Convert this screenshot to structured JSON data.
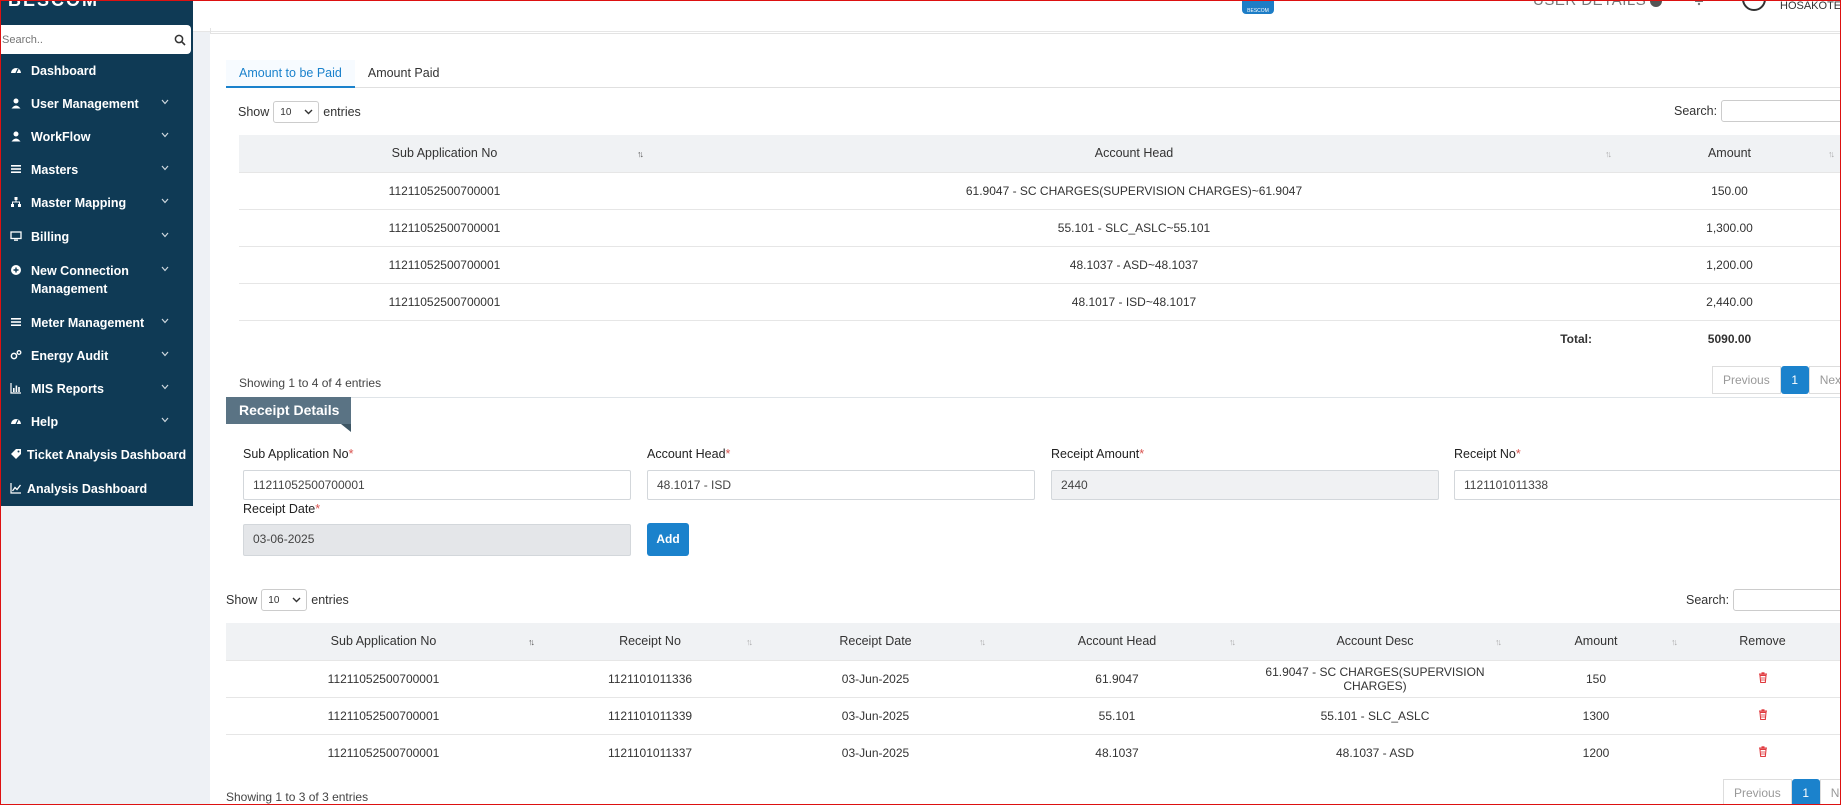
{
  "sidebar": {
    "brand": "BESCOM",
    "search_placeholder": "Search..",
    "items": [
      {
        "label": "Dashboard",
        "icon": "dashboard-icon",
        "chevron": false
      },
      {
        "label": "User Management",
        "icon": "user-icon",
        "chevron": true
      },
      {
        "label": "WorkFlow",
        "icon": "user-icon",
        "chevron": true
      },
      {
        "label": "Masters",
        "icon": "list-icon",
        "chevron": true
      },
      {
        "label": "Master Mapping",
        "icon": "sitemap-icon",
        "chevron": true
      },
      {
        "label": "Billing",
        "icon": "monitor-icon",
        "chevron": true
      },
      {
        "label": "New Connection Management",
        "icon": "plus-circle-icon",
        "chevron": true
      },
      {
        "label": "Meter Management",
        "icon": "list-icon",
        "chevron": true
      },
      {
        "label": "Energy Audit",
        "icon": "cogs-icon",
        "chevron": true
      },
      {
        "label": "MIS Reports",
        "icon": "bar-chart-icon",
        "chevron": true
      },
      {
        "label": "Help",
        "icon": "dashboard-icon",
        "chevron": true
      },
      {
        "label": "Ticket Analysis Dashboard",
        "icon": "tag-icon",
        "chevron": false
      },
      {
        "label": "Analysis Dashboard",
        "icon": "line-chart-icon",
        "chevron": false
      }
    ]
  },
  "header": {
    "logo_text": "BESCOM",
    "user_details": "USER DETAILS",
    "location": "HOSAKOTE"
  },
  "tabs": [
    {
      "label": "Amount to be Paid",
      "active": true
    },
    {
      "label": "Amount Paid",
      "active": false
    }
  ],
  "table1": {
    "show_label": "Show",
    "entries_label": "entries",
    "page_size": "10",
    "search_label": "Search:",
    "columns": [
      "Sub Application No",
      "Account Head",
      "Amount"
    ],
    "rows": [
      [
        "11211052500700001",
        "61.9047 - SC CHARGES(SUPERVISION CHARGES)~61.9047",
        "150.00"
      ],
      [
        "11211052500700001",
        "55.101 - SLC_ASLC~55.101",
        "1,300.00"
      ],
      [
        "11211052500700001",
        "48.1037 - ASD~48.1037",
        "1,200.00"
      ],
      [
        "11211052500700001",
        "48.1017 - ISD~48.1017",
        "2,440.00"
      ]
    ],
    "total_label": "Total:",
    "total_value": "5090.00",
    "info": "Showing 1 to 4 of 4 entries",
    "prev": "Previous",
    "page": "1",
    "next": "Next"
  },
  "receipt": {
    "title": "Receipt Details",
    "sub_app_label": "Sub Application No",
    "sub_app_value": "11211052500700001",
    "account_head_label": "Account Head",
    "account_head_value": "48.1017 - ISD",
    "receipt_amount_label": "Receipt Amount",
    "receipt_amount_value": "2440",
    "receipt_no_label": "Receipt No",
    "receipt_no_value": "1121101011338",
    "receipt_date_label": "Receipt Date",
    "receipt_date_value": "03-06-2025",
    "required_mark": "*",
    "add_label": "Add"
  },
  "table2": {
    "show_label": "Show",
    "entries_label": "entries",
    "page_size": "10",
    "search_label": "Search:",
    "columns": [
      "Sub Application No",
      "Receipt No",
      "Receipt Date",
      "Account Head",
      "Account Desc",
      "Amount",
      "Remove"
    ],
    "rows": [
      [
        "11211052500700001",
        "1121101011336",
        "03-Jun-2025",
        "61.9047",
        "61.9047 - SC CHARGES(SUPERVISION CHARGES)",
        "150"
      ],
      [
        "11211052500700001",
        "1121101011339",
        "03-Jun-2025",
        "55.101",
        "55.101 - SLC_ASLC",
        "1300"
      ],
      [
        "11211052500700001",
        "1121101011337",
        "03-Jun-2025",
        "48.1037",
        "48.1037 - ASD",
        "1200"
      ]
    ],
    "info": "Showing 1 to 3 of 3 entries",
    "prev": "Previous",
    "page": "1",
    "next": "Next"
  },
  "colors": {
    "sidebar_bg": "#0f3a55",
    "accent": "#1b82cc",
    "ribbon": "#5a7384",
    "danger": "#e0393e"
  }
}
